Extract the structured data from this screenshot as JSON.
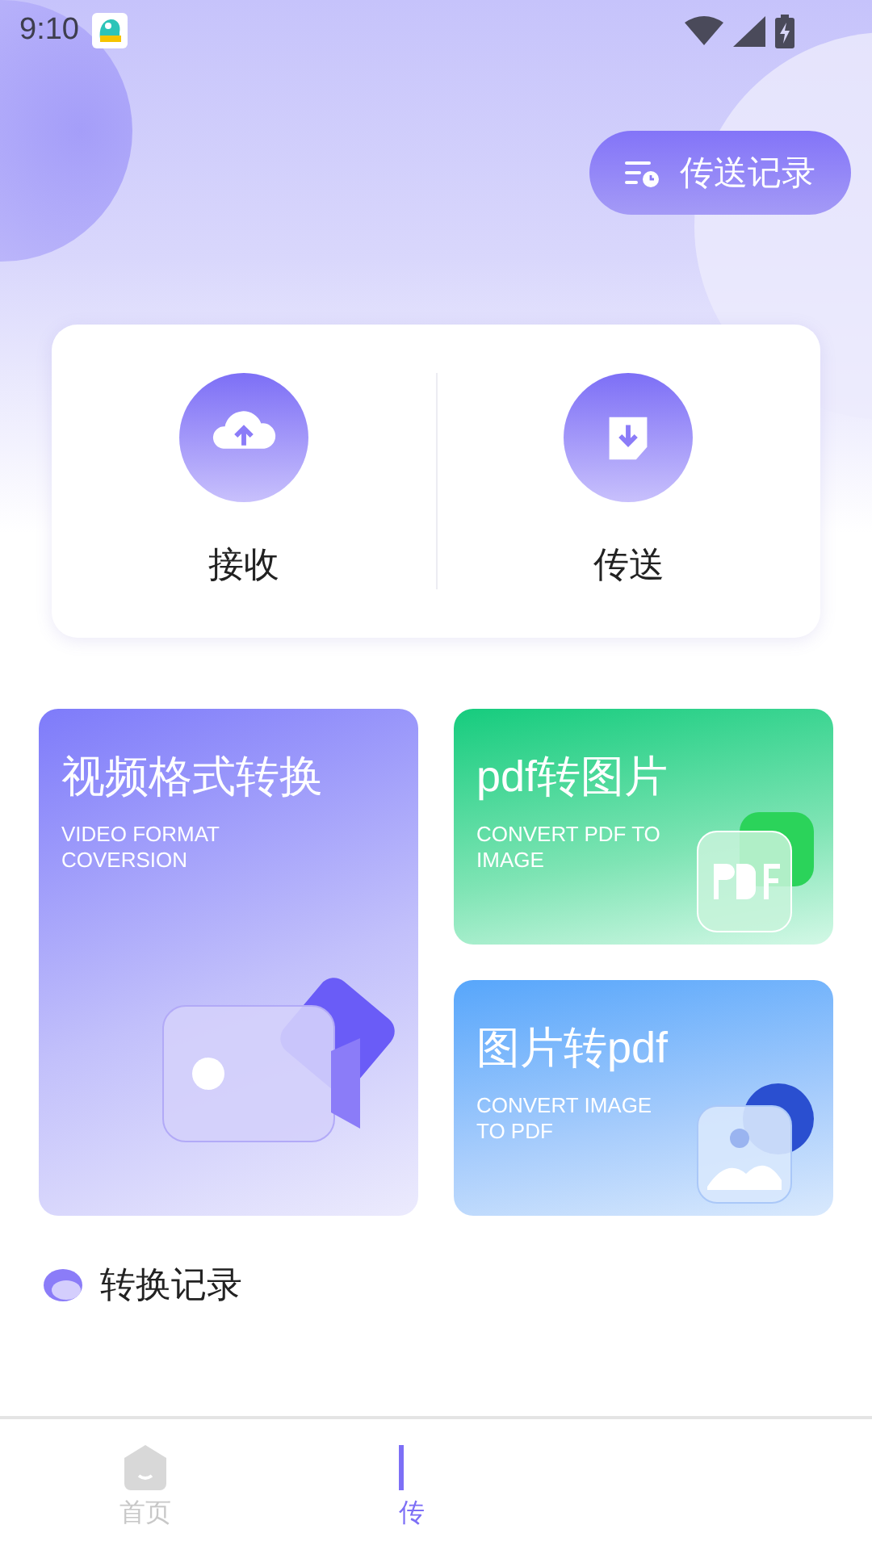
{
  "status_bar": {
    "time": "9:10"
  },
  "header_button": {
    "label": "传送记录"
  },
  "actions": [
    {
      "kind": "receive",
      "label": "接收"
    },
    {
      "kind": "send",
      "label": "传送"
    }
  ],
  "features": [
    {
      "kind": "video",
      "title": "视频格式转换",
      "subtitle_lines": [
        "VIDEO FORMAT",
        "COVERSION"
      ]
    },
    {
      "kind": "pdf_to_image",
      "title": "pdf转图片",
      "subtitle_lines": [
        "CONVERT PDF TO",
        "IMAGE"
      ]
    },
    {
      "kind": "image_to_pdf",
      "title": "图片转pdf",
      "subtitle_lines": [
        "CONVERT IMAGE",
        "TO PDF"
      ]
    }
  ],
  "records_heading": "转换记录",
  "nav": [
    {
      "label": "首页",
      "selected": false
    },
    {
      "label": "传",
      "selected": true
    }
  ]
}
